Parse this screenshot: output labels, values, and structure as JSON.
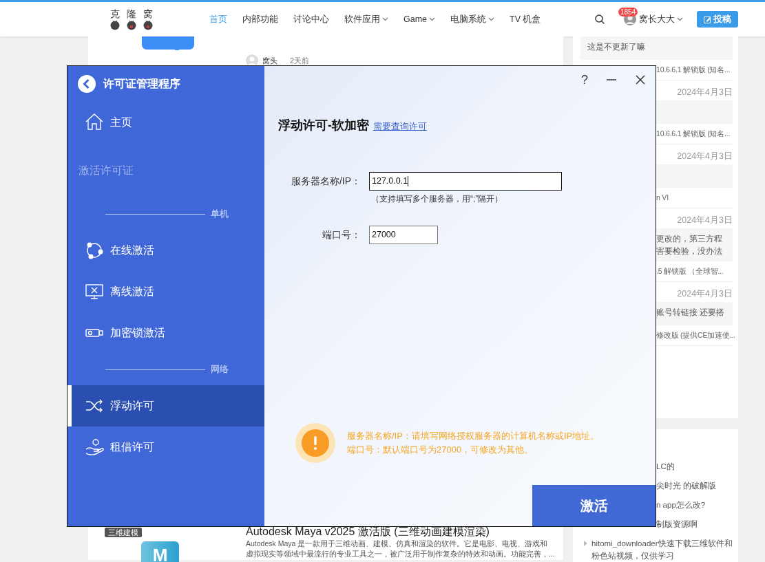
{
  "site": {
    "logo": [
      "克",
      "隆",
      "窝"
    ],
    "nav": [
      {
        "label": "首页",
        "selected": true,
        "dropdown": false
      },
      {
        "label": "内部功能",
        "selected": false,
        "dropdown": false
      },
      {
        "label": "讨论中心",
        "selected": false,
        "dropdown": false
      },
      {
        "label": "软件应用",
        "selected": false,
        "dropdown": true
      },
      {
        "label": "Game",
        "selected": false,
        "dropdown": true
      },
      {
        "label": "电脑系统",
        "selected": false,
        "dropdown": true
      },
      {
        "label": "TV 机盒",
        "selected": false,
        "dropdown": false
      }
    ],
    "user": {
      "name": "窝长大大",
      "badge": "1854"
    },
    "post_button": "投稿"
  },
  "feed": {
    "author": "窝头",
    "time": "2天前",
    "post": {
      "tag": "三维建模",
      "logo_text": "M",
      "title": "Autodesk Maya v2025 激活版 (三维动画建模渲染)",
      "excerpt": [
        "Autodesk Maya 是一款用于三维动画、建模、仿真和渲染的软件。它是电影、电视、游戏和",
        "虚拟现实等领域中最流行的专业工具之一，被广泛用于制作复杂的特效和动画。功能完善，..."
      ]
    }
  },
  "recent_comments": [
    {
      "quote": [
        "这是不更新了嘛"
      ],
      "source": "10.6.6.1 解锁版 (知名..."
    },
    {
      "date": "2024年4月3日",
      "source": "10.6.6.1 解锁版 (知名..."
    },
    {
      "date": "2024年4月3日",
      "source": "n VI"
    },
    {
      "date": "2024年4月3日",
      "quote": [
        "更改的，第三方程",
        "害要检验，没办法"
      ],
      "source": ".5 解锁版 （全球智..."
    },
    {
      "date": "2024年4月3日",
      "quote": [
        "账号转链接 还要搭"
      ],
      "source": "修改版 (提供CE加速使..."
    }
  ],
  "hot_posts": [
    {
      "lines": [
        "LC的"
      ]
    },
    {
      "lines": [
        "尖时光 的破解版"
      ]
    },
    {
      "lines": [
        "n app怎么改?"
      ]
    },
    {
      "lines": [
        "制版资源啊"
      ]
    },
    {
      "lines": [
        "hitomi_downloader快速下载三维软件和",
        "粉色站视频，仅供学习"
      ]
    }
  ],
  "dialog": {
    "title": "许可证管理程序",
    "help": "?",
    "menu": [
      {
        "kind": "item",
        "label": "主页",
        "selected": false
      },
      {
        "kind": "heading",
        "label": "激活许可证"
      },
      {
        "kind": "section",
        "label": "单机"
      },
      {
        "kind": "item",
        "label": "在线激活",
        "selected": false
      },
      {
        "kind": "item",
        "label": "离线激活",
        "selected": false
      },
      {
        "kind": "item",
        "label": "加密锁激活",
        "selected": false
      },
      {
        "kind": "section",
        "label": "网络"
      },
      {
        "kind": "item",
        "label": "浮动许可",
        "selected": true
      },
      {
        "kind": "item",
        "label": "租借许可",
        "selected": false
      }
    ],
    "heading": "浮动许可-软加密",
    "link": "需要查询许可",
    "fields": [
      {
        "label": "服务器名称/IP：",
        "value": "127.0.0.1",
        "hint": "（支持填写多个服务器，用“;”隔开）",
        "focused": true
      },
      {
        "label": "端口号：",
        "value": "27000",
        "focused": false
      }
    ],
    "notice": [
      "服务器名称/IP：请填写网络授权服务器的计算机名称或IP地址。",
      "端口号：默认端口号为27000，可修改为其他。"
    ],
    "action": "激活"
  }
}
